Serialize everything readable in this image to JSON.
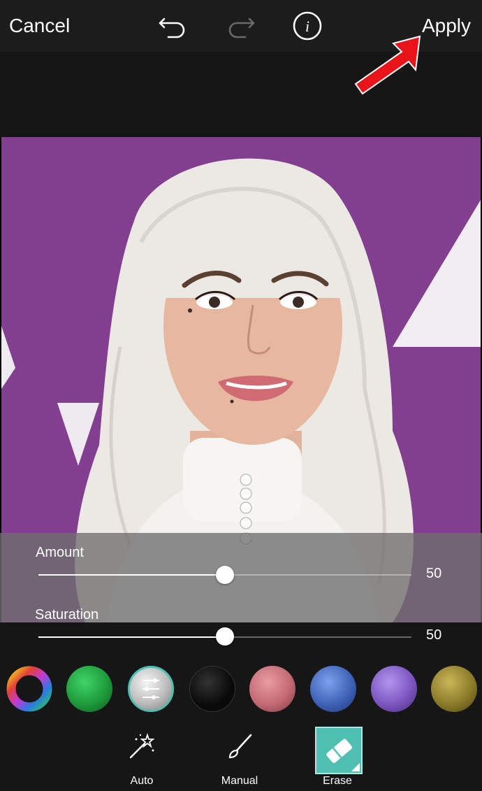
{
  "topbar": {
    "cancel_label": "Cancel",
    "apply_label": "Apply",
    "icons": [
      "undo-icon",
      "redo-icon",
      "info-icon"
    ]
  },
  "sliders": {
    "amount": {
      "label": "Amount",
      "value": "50",
      "level": 0.5
    },
    "saturation": {
      "label": "Saturation",
      "value": "50",
      "level": 0.5
    }
  },
  "swatches": [
    {
      "name": "color-wheel"
    },
    {
      "name": "green",
      "color": "#1e9b3a"
    },
    {
      "name": "silver",
      "color": "#bdbdbd",
      "selected": true
    },
    {
      "name": "black",
      "color": "#0a0a0a"
    },
    {
      "name": "rose",
      "color": "#c46a74"
    },
    {
      "name": "blue",
      "color": "#3f63b8"
    },
    {
      "name": "purple",
      "color": "#7d56c0"
    },
    {
      "name": "olive-gold",
      "color": "#8c7c2a"
    }
  ],
  "tools": [
    {
      "label": "Auto",
      "icon": "magic-wand-icon"
    },
    {
      "label": "Manual",
      "icon": "brush-icon"
    },
    {
      "label": "Erase",
      "icon": "eraser-icon",
      "selected": true
    }
  ],
  "colors": {
    "accent": "#4fbfb1",
    "arrow": "#e8141a",
    "background_photo": "#7e3c8c"
  }
}
